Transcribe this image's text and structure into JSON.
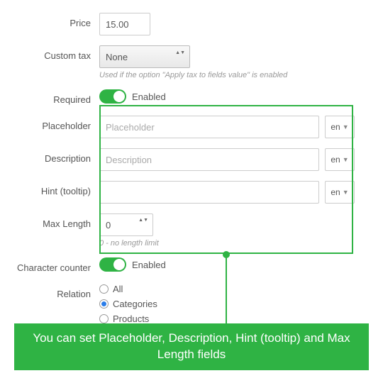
{
  "fields": {
    "price": {
      "label": "Price",
      "value": "15.00"
    },
    "custom_tax": {
      "label": "Custom tax",
      "value": "None",
      "help": "Used if the option \"Apply tax to fields value\" is enabled"
    },
    "required": {
      "label": "Required",
      "state": "Enabled"
    },
    "placeholder": {
      "label": "Placeholder",
      "input_placeholder": "Placeholder",
      "lang": "en"
    },
    "description": {
      "label": "Description",
      "input_placeholder": "Description",
      "lang": "en"
    },
    "hint": {
      "label": "Hint (tooltip)",
      "input_placeholder": "",
      "lang": "en"
    },
    "max_length": {
      "label": "Max Length",
      "value": "0",
      "help": "0 - no length limit"
    },
    "character_counter": {
      "label": "Character counter",
      "state": "Enabled"
    },
    "relation": {
      "label": "Relation",
      "options": [
        "All",
        "Categories",
        "Products"
      ],
      "selected": "Categories"
    }
  },
  "caption": "You can set Placeholder, Description, Hint (tooltip) and Max Length fields"
}
